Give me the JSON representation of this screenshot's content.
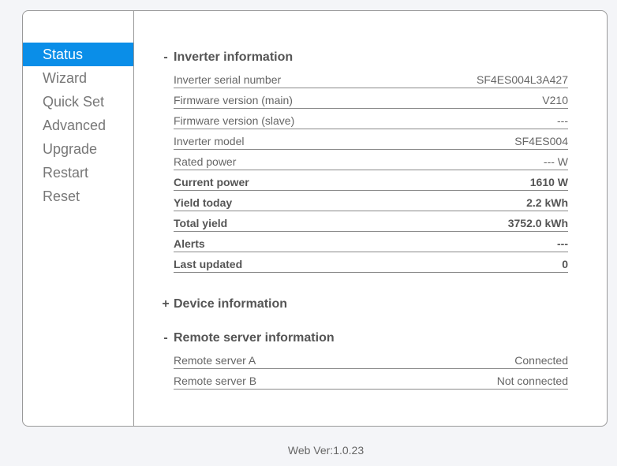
{
  "nav": {
    "items": [
      {
        "label": "Status"
      },
      {
        "label": "Wizard"
      },
      {
        "label": "Quick Set"
      },
      {
        "label": "Advanced"
      },
      {
        "label": "Upgrade"
      },
      {
        "label": "Restart"
      },
      {
        "label": "Reset"
      }
    ],
    "active": "Status"
  },
  "inverter": {
    "toggle": "-",
    "title": "Inverter information",
    "rows": [
      {
        "label": "Inverter serial number",
        "value": "SF4ES004L3A427"
      },
      {
        "label": "Firmware version (main)",
        "value": "V210"
      },
      {
        "label": "Firmware version (slave)",
        "value": "---"
      },
      {
        "label": "Inverter model",
        "value": "SF4ES004"
      },
      {
        "label": "Rated power",
        "value": "--- W"
      },
      {
        "label": "Current power",
        "value": "1610 W"
      },
      {
        "label": "Yield today",
        "value": "2.2 kWh"
      },
      {
        "label": "Total yield",
        "value": "3752.0 kWh"
      },
      {
        "label": "Alerts",
        "value": "---"
      },
      {
        "label": "Last updated",
        "value": "0"
      }
    ]
  },
  "device": {
    "toggle": "+",
    "title": "Device information"
  },
  "remote": {
    "toggle": "-",
    "title": "Remote server information",
    "rows": [
      {
        "label": "Remote server A",
        "value": "Connected"
      },
      {
        "label": "Remote server B",
        "value": "Not connected"
      }
    ]
  },
  "footer": {
    "version": "Web Ver:1.0.23"
  },
  "colors": {
    "accent": "#0a8ee8"
  }
}
